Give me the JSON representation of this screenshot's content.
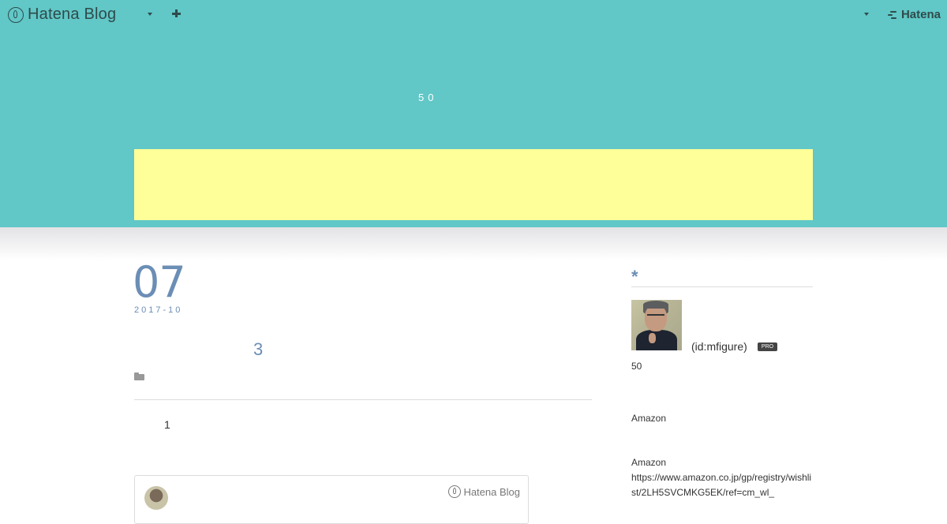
{
  "topbar": {
    "brand_label": "Hatena Blog",
    "hatena_label": "Hatena"
  },
  "header": {
    "description": "50",
    "banner_color": "#ffff99",
    "background_color": "#61c7c7"
  },
  "entry": {
    "day": "07",
    "year_month": "2017-10",
    "title": "3",
    "body": "1"
  },
  "embed": {
    "brand_label": "Hatena Blog"
  },
  "sidebar": {
    "title": "*",
    "profile_id": "(id:mfigure)",
    "pro_label": "PRO",
    "age_text": "50",
    "amazon_label": "Amazon",
    "amazon_label_2": "Amazon",
    "amazon_url": "https://www.amazon.co.jp/gp/registry/wishlist/2LH5SVCMKG5EK/ref=cm_wl_"
  }
}
